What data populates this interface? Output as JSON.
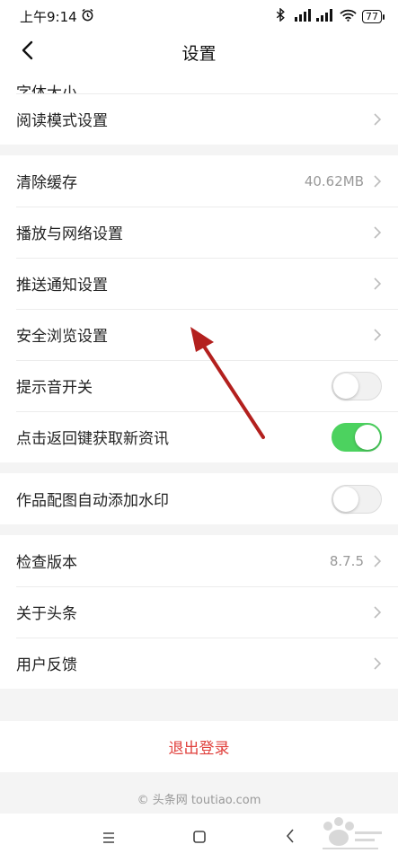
{
  "status_bar": {
    "time": "上午9:14",
    "battery": "77"
  },
  "header": {
    "title": "设置"
  },
  "partial_row": {
    "label": "字体大小"
  },
  "groups": [
    {
      "items": [
        {
          "label": "阅读模式设置"
        }
      ]
    },
    {
      "items": [
        {
          "label": "清除缓存",
          "value": "40.62MB"
        },
        {
          "label": "播放与网络设置"
        },
        {
          "label": "推送通知设置"
        },
        {
          "label": "安全浏览设置"
        },
        {
          "label": "提示音开关",
          "toggle": false
        },
        {
          "label": "点击返回键获取新资讯",
          "toggle": true
        }
      ]
    },
    {
      "items": [
        {
          "label": "作品配图自动添加水印",
          "toggle": false
        }
      ]
    },
    {
      "items": [
        {
          "label": "检查版本",
          "value": "8.7.5"
        },
        {
          "label": "关于头条"
        },
        {
          "label": "用户反馈"
        }
      ]
    }
  ],
  "logout": {
    "label": "退出登录"
  },
  "footer": {
    "text": "© 头条网 toutiao.com"
  },
  "colors": {
    "accent_red": "#e0403c",
    "toggle_on": "#4cd25f",
    "arrow": "#b3201e"
  },
  "icons": {
    "back": "chevron-left-icon",
    "row": "chevron-right-icon",
    "alarm": "alarm-icon",
    "bluetooth": "bluetooth-icon",
    "wifi": "wifi-icon"
  }
}
